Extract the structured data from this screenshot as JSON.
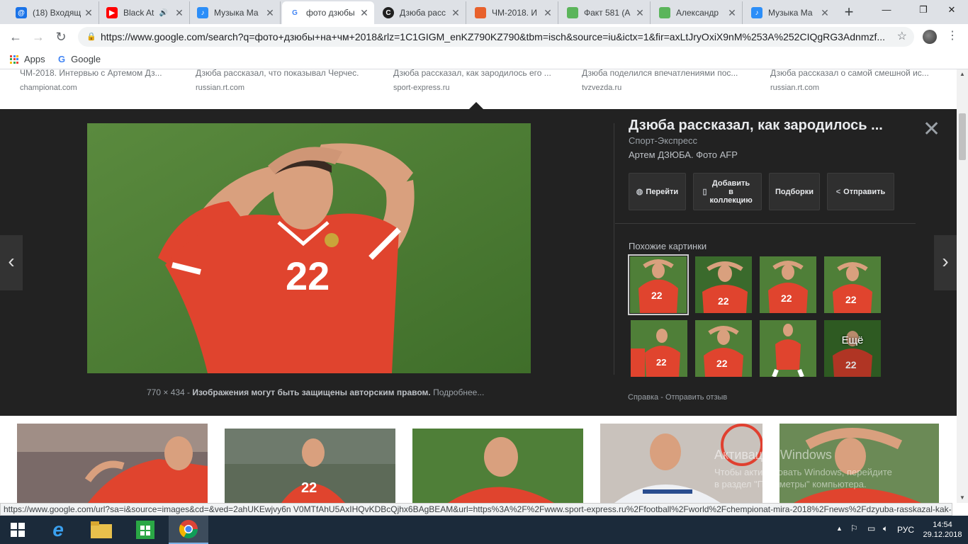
{
  "tabs": [
    {
      "label": "(18) Входящ",
      "favicon": "at-icon",
      "color": "#1a73e8"
    },
    {
      "label": "Black At",
      "favicon": "youtube-icon",
      "color": "#ff0000",
      "audio": "🔊"
    },
    {
      "label": "Музыка Ма",
      "favicon": "music-icon",
      "color": "#2c8ef8"
    },
    {
      "label": "фото дзюбы",
      "favicon": "google-icon",
      "color": "#4285f4"
    },
    {
      "label": "Дзюба расс",
      "favicon": "sportexpress-icon",
      "color": "#1f1f1f"
    },
    {
      "label": "ЧМ-2018. И",
      "favicon": "championat-icon",
      "color": "#e8612c"
    },
    {
      "label": "Факт 581 (А",
      "favicon": "green-doc-icon",
      "color": "#5bb55b"
    },
    {
      "label": "Александр",
      "favicon": "green-doc-icon",
      "color": "#5bb55b"
    },
    {
      "label": "Музыка Ма",
      "favicon": "music-icon",
      "color": "#2c8ef8"
    }
  ],
  "toolbar": {
    "url": "https://www.google.com/search?q=фото+дзюбы+на+чм+2018&rlz=1C1GIGM_enKZ790KZ790&tbm=isch&source=iu&ictx=1&fir=axLtJryOxiX9nM%253A%252CIQgRG3Adnmzf..."
  },
  "bookmarks": {
    "apps": "Apps",
    "google": "Google"
  },
  "results_top": [
    {
      "title": "ЧМ-2018. Интервью с Артемом Дз...",
      "source": "championat.com"
    },
    {
      "title": "Дзюба рассказал, что показывал Черчес...",
      "source": "russian.rt.com"
    },
    {
      "title": "Дзюба рассказал, как зародилось его ...",
      "source": "sport-express.ru"
    },
    {
      "title": "Дзюба поделился впечатлениями пос...",
      "source": "tvzvezda.ru"
    },
    {
      "title": "Дзюба рассказал о самой смешной ис...",
      "source": "russian.rt.com"
    }
  ],
  "panel": {
    "title": "Дзюба рассказал, как зародилось ...",
    "source": "Спорт-Экспресс",
    "description": "Артем ДЗЮБА. Фото AFP",
    "close": "✕",
    "buttons": {
      "visit": "Перейти",
      "save": "Добавить в коллекцию",
      "collections": "Подборки",
      "share": "Отправить"
    },
    "similar_label": "Похожие картинки",
    "more": "Ещё",
    "image_size": "770 × 434",
    "separator": " - ",
    "copyright": "Изображения могут быть защищены авторским правом.",
    "more_info": "Подробнее...",
    "help": "Справка",
    "feedback": "Отправить отзыв",
    "jersey_number": "22"
  },
  "watermark": {
    "line1": "Активация Windows",
    "line2": "Чтобы активировать Windows, перейдите",
    "line3": "в раздел \"Параметры\" компьютера."
  },
  "statusbar": {
    "url": "https://www.google.com/url?sa=i&source=images&cd=&ved=2ahUKEwjvy6n V0MTfAhU5AxIHQvKDBcQjhx6BAgBEAM&url=https%3A%2F%2Fwww.sport-express.ru%2Ffootball%2Fworld%2Fchempionat-mira-2018%2Fnews%2Fdzyuba-rasskazal-kak-z..."
  },
  "taskbar": {
    "lang": "РУС",
    "time": "14:54",
    "date": "29.12.2018"
  }
}
